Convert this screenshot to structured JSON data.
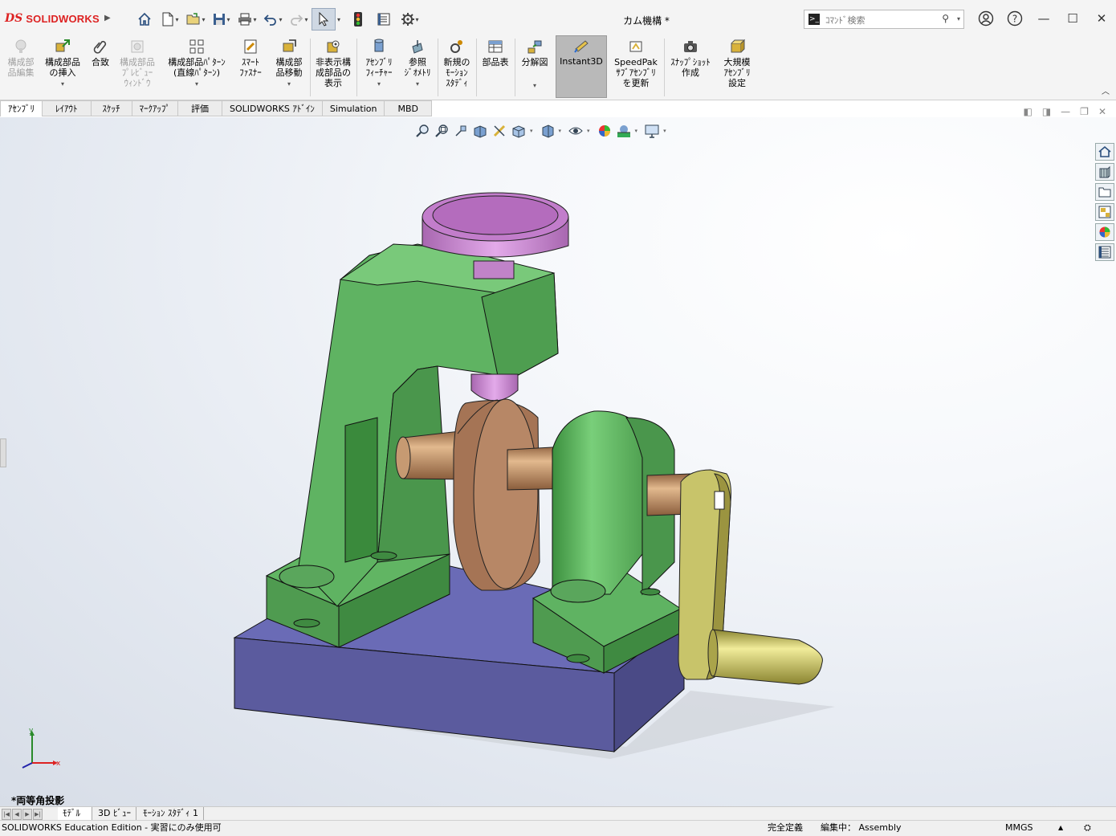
{
  "app": {
    "logo_ds": "DS",
    "logo_text": "SOLIDWORKS",
    "document_title": "カム機構 *"
  },
  "search": {
    "placeholder": "ｺﾏﾝﾄﾞ検索"
  },
  "ribbon": {
    "commands": [
      {
        "id": "edit-component",
        "label": "構成部\n品編集",
        "enabled": false
      },
      {
        "id": "insert-components",
        "label": "構成部品\nの挿入",
        "enabled": true,
        "has_dropdown": true
      },
      {
        "id": "mate",
        "label": "合致",
        "enabled": true
      },
      {
        "id": "component-preview",
        "label": "構成部品\nﾌﾟﾚﾋﾞｭｰ\nｳｨﾝﾄﾞｳ",
        "enabled": false
      },
      {
        "id": "linear-pattern",
        "label": "構成部品ﾊﾟﾀｰﾝ\n(直線ﾊﾟﾀｰﾝ)",
        "enabled": true,
        "has_dropdown": true
      },
      {
        "id": "smart-fasteners",
        "label": "ｽﾏｰﾄ\nﾌｧｽﾅｰ",
        "enabled": true
      },
      {
        "id": "move-component",
        "label": "構成部\n品移動",
        "enabled": true,
        "has_dropdown": true
      },
      {
        "id": "show-hidden",
        "label": "非表示構\n成部品の\n表示",
        "enabled": true
      },
      {
        "id": "assembly-features",
        "label": "ｱｾﾝﾌﾞﾘ\nﾌｨｰﾁｬｰ",
        "enabled": true,
        "has_dropdown": true
      },
      {
        "id": "reference-geometry",
        "label": "参照\nｼﾞｵﾒﾄﾘ",
        "enabled": true,
        "has_dropdown": true
      },
      {
        "id": "new-motion-study",
        "label": "新規の\nﾓｰｼｮﾝ\nｽﾀﾃﾞｨ",
        "enabled": true
      },
      {
        "id": "bom",
        "label": "部品表",
        "enabled": true
      },
      {
        "id": "exploded-view",
        "label": "分解図",
        "enabled": true,
        "has_dropdown": true
      },
      {
        "id": "instant3d",
        "label": "Instant3D",
        "enabled": true,
        "active": true
      },
      {
        "id": "speedpak",
        "label": "SpeedPak\nｻﾌﾞｱｾﾝﾌﾞﾘ\nを更新",
        "enabled": true
      },
      {
        "id": "snapshot",
        "label": "ｽﾅｯﾌﾟｼｮｯﾄ\n作成",
        "enabled": true
      },
      {
        "id": "large-assembly",
        "label": "大規模\nｱｾﾝﾌﾞﾘ\n設定",
        "enabled": true
      }
    ]
  },
  "tabs": [
    "ｱｾﾝﾌﾞﾘ",
    "ﾚｲｱｳﾄ",
    "ｽｹｯﾁ",
    "ﾏｰｸｱｯﾌﾟ",
    "評価",
    "SOLIDWORKS ｱﾄﾞｲﾝ",
    "Simulation",
    "MBD"
  ],
  "active_tab": 0,
  "viewport": {
    "view_name": "*両等角投影",
    "triad": {
      "x": "x",
      "y": "y"
    }
  },
  "bottom_tabs": [
    "ﾓﾃﾞﾙ",
    "3D ﾋﾞｭｰ",
    "ﾓｰｼｮﾝ ｽﾀﾃﾞｨ 1"
  ],
  "active_bottom_tab": 0,
  "status": {
    "edition": "SOLIDWORKS Education Edition - 実習にのみ使用可",
    "definition": "完全定義",
    "editing": "編集中： Assembly",
    "units": "MMGS",
    "units_arrow": "▲"
  },
  "colors": {
    "frame": "#5aa05a",
    "base": "#5a5aa0",
    "cam": "#b08060",
    "knob": "#b070b8",
    "handle": "#c8c070",
    "accent_red": "#d22222"
  }
}
